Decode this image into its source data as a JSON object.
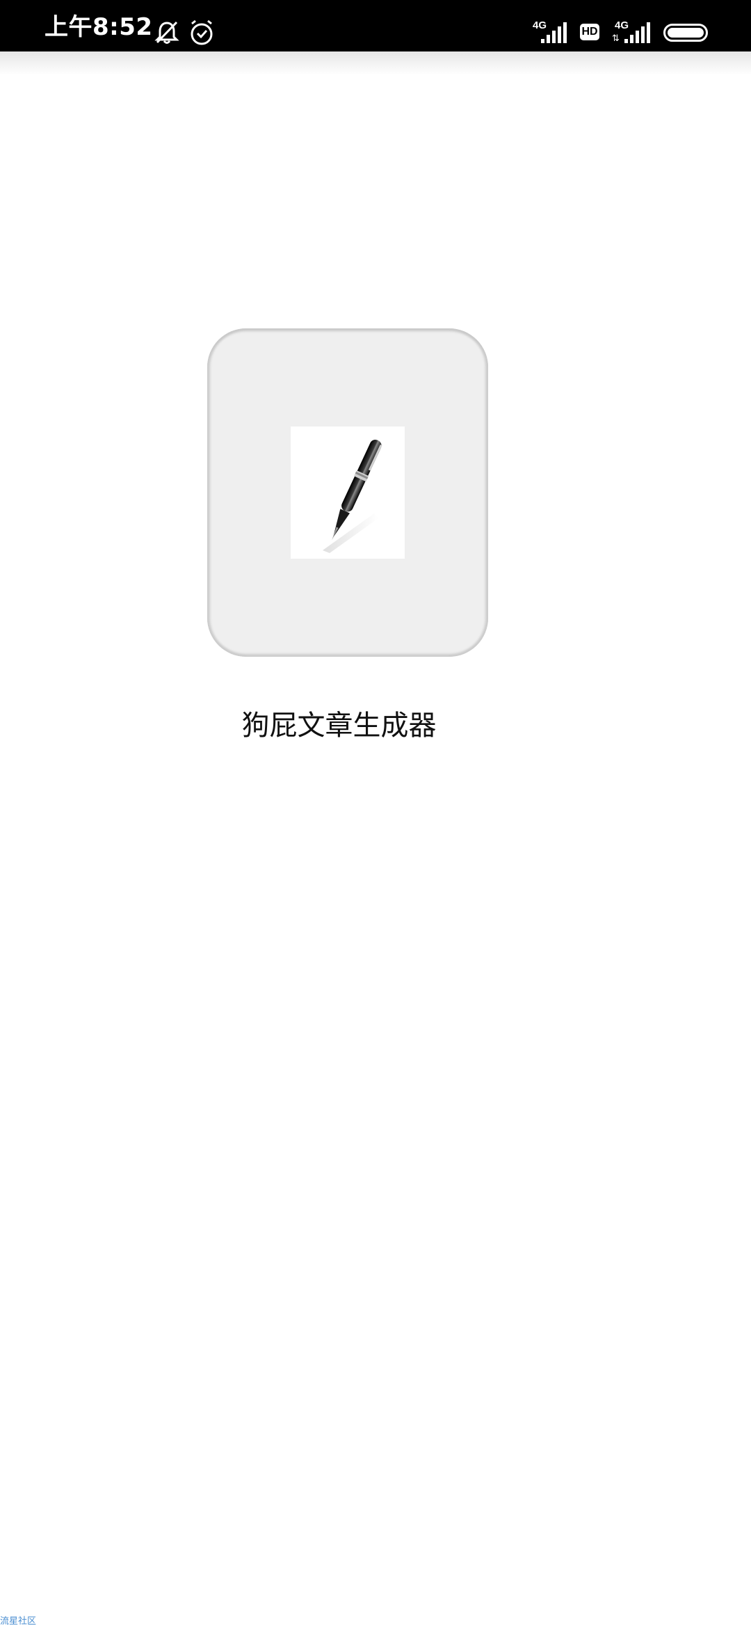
{
  "status_bar": {
    "time": "上午8:52",
    "icons": [
      "silent-icon",
      "alarm-icon",
      "signal-icon",
      "hd-badge",
      "signal-icon",
      "battery-icon"
    ],
    "sim1_network": "4G",
    "hd_label": "HD",
    "sim2_network": "4G",
    "battery_level": 1.0
  },
  "app": {
    "icon": "pen-icon",
    "name": "狗屁文章生成器",
    "card_color": "#efefef"
  },
  "watermark": {
    "text": "流星社区"
  }
}
